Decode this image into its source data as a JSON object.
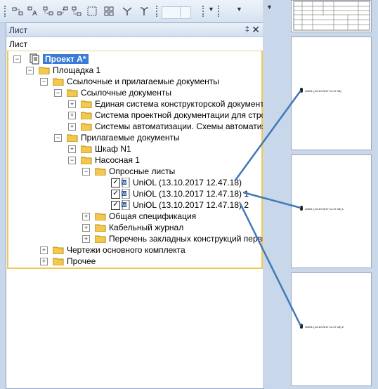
{
  "panel": {
    "title": "Лист",
    "pin_symbol": "‡",
    "close_symbol": "✕",
    "subheader": "Лист"
  },
  "tree": {
    "root": "Проект А*",
    "site": "Площадка 1",
    "ref_and_attached": "Ссылочные и прилагаемые документы",
    "ref_docs": "Ссылочные документы",
    "ref_items": [
      "Единая система конструкторской документац",
      "Система проектной документации для строит.",
      "Системы автоматизации. Схемы автоматизац"
    ],
    "attached_docs": "Прилагаемые документы",
    "cabinet": "Шкаф N1",
    "pump": "Насосная 1",
    "questionnaires": "Опросные листы",
    "uniol_items": [
      "UniOL (13.10.2017 12.47.18)",
      "UniOL (13.10.2017 12.47.18) 1",
      "UniOL (13.10.2017 12.47.18) 2"
    ],
    "pump_children": [
      "Общая спецификация",
      "Кабельный журнал",
      "Перечень закладных конструкций первич."
    ],
    "main_drawings": "Чертежи основного комплекта",
    "other": "Прочее"
  },
  "pages": {
    "labels": [
      "UniOL (13.10.2017 12.47.18)",
      "UniOL (13.10.2017 12.47.18) 1",
      "UniOL (13.10.2017 12.47.18) 2"
    ]
  },
  "colors": {
    "selection": "#3a7bd5",
    "link_lines": "#3f78b8",
    "folder": "#f2c94c"
  }
}
